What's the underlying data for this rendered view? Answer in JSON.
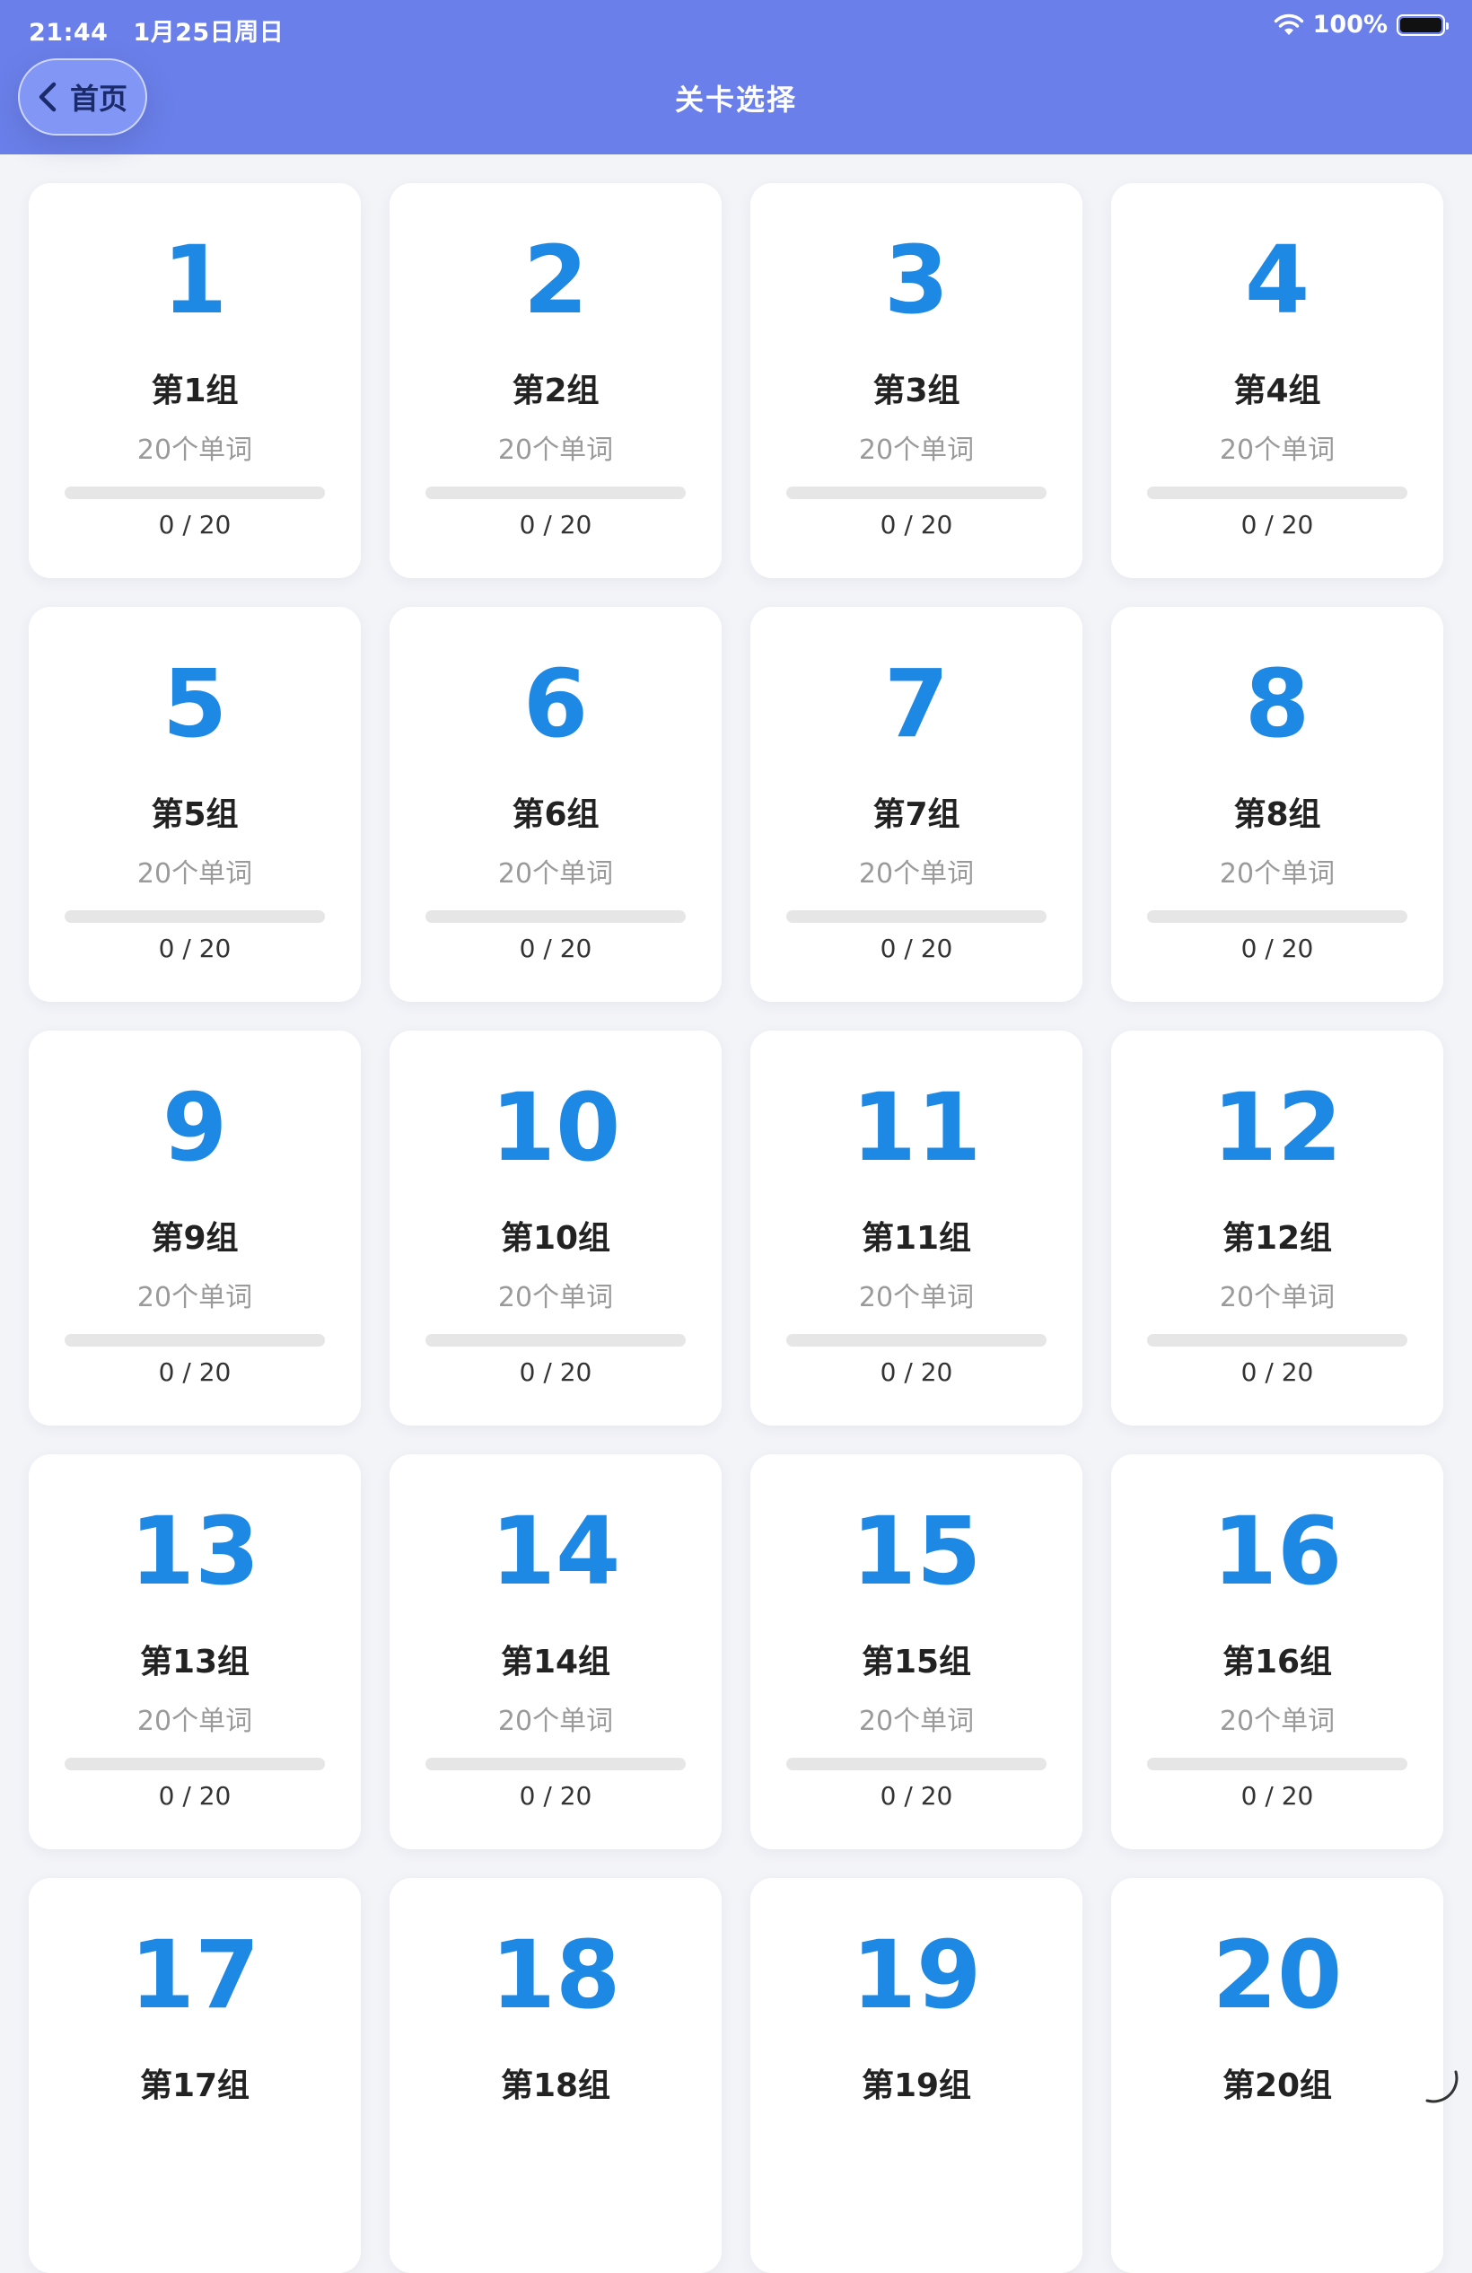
{
  "status_bar": {
    "time": "21:44",
    "date": "1月25日周日",
    "battery": "100%"
  },
  "header": {
    "back_label": "首页",
    "title": "关卡选择"
  },
  "colors": {
    "header_bg": "#6a7fe9",
    "accent": "#1e88e5",
    "page_bg": "#f3f4f8"
  },
  "levels": [
    {
      "number": "1",
      "name": "第1组",
      "words": "20个单词",
      "progress_text": "0 / 20",
      "progress": 0
    },
    {
      "number": "2",
      "name": "第2组",
      "words": "20个单词",
      "progress_text": "0 / 20",
      "progress": 0
    },
    {
      "number": "3",
      "name": "第3组",
      "words": "20个单词",
      "progress_text": "0 / 20",
      "progress": 0
    },
    {
      "number": "4",
      "name": "第4组",
      "words": "20个单词",
      "progress_text": "0 / 20",
      "progress": 0
    },
    {
      "number": "5",
      "name": "第5组",
      "words": "20个单词",
      "progress_text": "0 / 20",
      "progress": 0
    },
    {
      "number": "6",
      "name": "第6组",
      "words": "20个单词",
      "progress_text": "0 / 20",
      "progress": 0
    },
    {
      "number": "7",
      "name": "第7组",
      "words": "20个单词",
      "progress_text": "0 / 20",
      "progress": 0
    },
    {
      "number": "8",
      "name": "第8组",
      "words": "20个单词",
      "progress_text": "0 / 20",
      "progress": 0
    },
    {
      "number": "9",
      "name": "第9组",
      "words": "20个单词",
      "progress_text": "0 / 20",
      "progress": 0
    },
    {
      "number": "10",
      "name": "第10组",
      "words": "20个单词",
      "progress_text": "0 / 20",
      "progress": 0
    },
    {
      "number": "11",
      "name": "第11组",
      "words": "20个单词",
      "progress_text": "0 / 20",
      "progress": 0
    },
    {
      "number": "12",
      "name": "第12组",
      "words": "20个单词",
      "progress_text": "0 / 20",
      "progress": 0
    },
    {
      "number": "13",
      "name": "第13组",
      "words": "20个单词",
      "progress_text": "0 / 20",
      "progress": 0
    },
    {
      "number": "14",
      "name": "第14组",
      "words": "20个单词",
      "progress_text": "0 / 20",
      "progress": 0
    },
    {
      "number": "15",
      "name": "第15组",
      "words": "20个单词",
      "progress_text": "0 / 20",
      "progress": 0
    },
    {
      "number": "16",
      "name": "第16组",
      "words": "20个单词",
      "progress_text": "0 / 20",
      "progress": 0
    },
    {
      "number": "17",
      "name": "第17组",
      "words": "",
      "progress_text": "",
      "progress": 0
    },
    {
      "number": "18",
      "name": "第18组",
      "words": "",
      "progress_text": "",
      "progress": 0
    },
    {
      "number": "19",
      "name": "第19组",
      "words": "",
      "progress_text": "",
      "progress": 0
    },
    {
      "number": "20",
      "name": "第20组",
      "words": "",
      "progress_text": "",
      "progress": 0
    }
  ]
}
